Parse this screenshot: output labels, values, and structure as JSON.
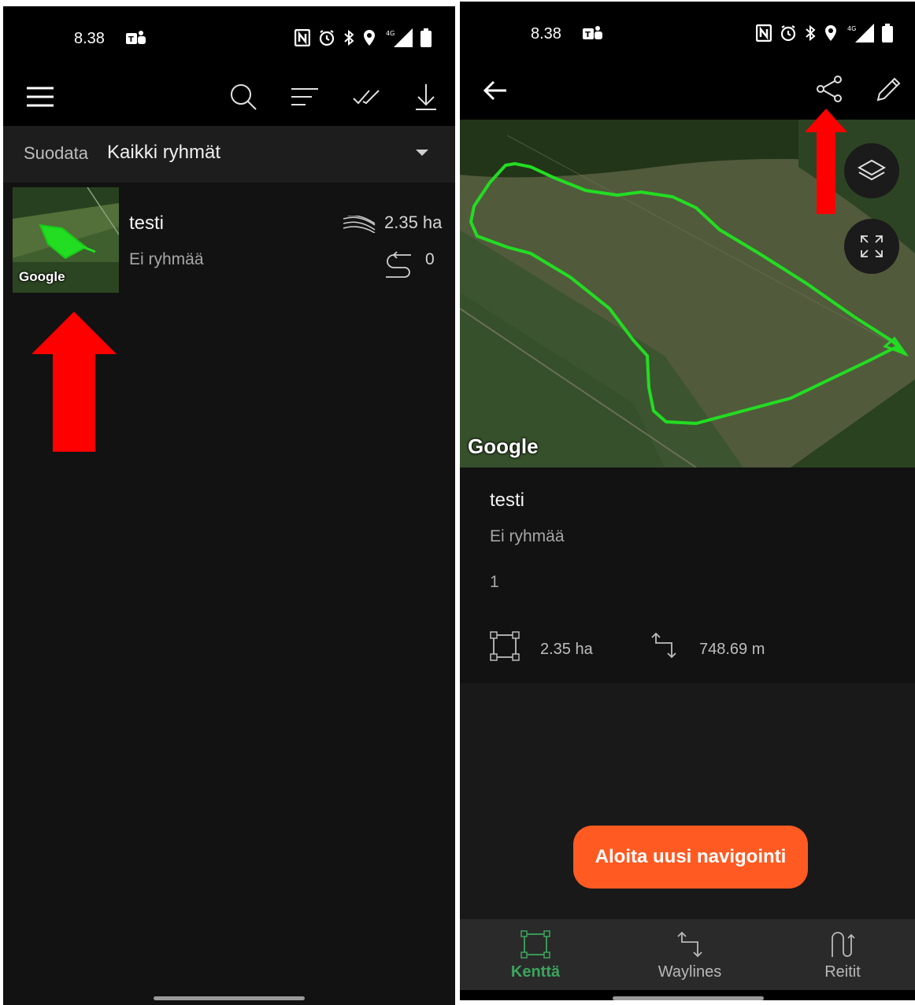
{
  "left_screen": {
    "status": {
      "time": "8.38",
      "network_label": "4G"
    },
    "filter": {
      "label": "Suodata",
      "value": "Kaikki ryhmät"
    },
    "field_item": {
      "name": "testi",
      "group": "Ei ryhmää",
      "area": "2.35 ha",
      "lines": "0",
      "thumbnail_attribution": "Google"
    },
    "annotation_color": "#ff0000"
  },
  "right_screen": {
    "status": {
      "time": "8.38",
      "network_label": "4G"
    },
    "map": {
      "attribution": "Google",
      "boundary_color": "#22dd22"
    },
    "details": {
      "name": "testi",
      "group": "Ei ryhmää",
      "count": "1",
      "area": "2.35 ha",
      "length": "748.69 m"
    },
    "cta_label": "Aloita uusi navigointi",
    "cta_color": "#ff5a22",
    "bottom_nav": [
      {
        "label": "Kenttä",
        "icon": "field-icon",
        "active": true
      },
      {
        "label": "Waylines",
        "icon": "waylines-icon",
        "active": false
      },
      {
        "label": "Reitit",
        "icon": "routes-icon",
        "active": false
      }
    ],
    "accent_color": "#3ba55c",
    "annotation_color": "#ff0000"
  }
}
